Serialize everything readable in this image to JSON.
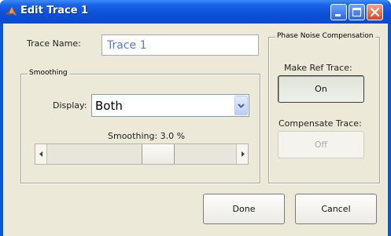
{
  "window": {
    "title": "Edit Trace 1",
    "icon": "matlab-icon",
    "controls": {
      "minimize_icon": "minimize-icon",
      "maximize_icon": "maximize-icon",
      "close_icon": "close-icon"
    }
  },
  "trace": {
    "name_label": "Trace Name:",
    "name_value": "Trace 1"
  },
  "smoothing": {
    "group_title": "Smoothing",
    "display_label": "Display:",
    "display_value": "Both",
    "slider_label": "Smoothing: 3.0 %",
    "slider_level_fraction": 0.58
  },
  "phase_noise": {
    "group_title": "Phase Noise Compensation",
    "make_ref_label": "Make Ref Trace:",
    "make_ref_button": "On",
    "compensate_label": "Compensate Trace:",
    "compensate_button": "Off"
  },
  "actions": {
    "done": "Done",
    "cancel": "Cancel"
  },
  "colors": {
    "titlebar": "#0a51d8",
    "dialog_bg": "#ece9d8",
    "trace_name_text": "#5a78e6",
    "close_button": "#d9461c"
  }
}
